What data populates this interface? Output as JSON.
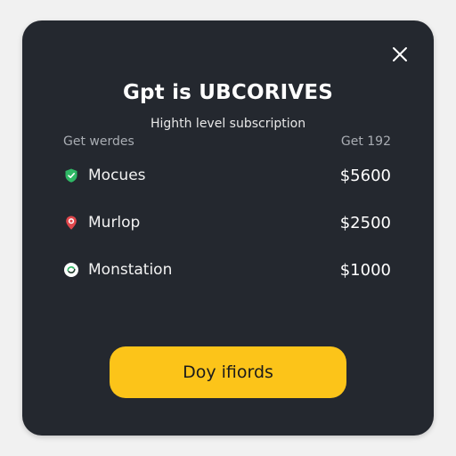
{
  "dialog": {
    "title": "Gpt is UBCORIVES",
    "subtitle": "Highth level subscription",
    "close_icon": "close-icon"
  },
  "table": {
    "header_left": "Get werdes",
    "header_right": "Get 192"
  },
  "plans": [
    {
      "name": "Mocues",
      "price": "$5600",
      "icon": "shield-check-icon",
      "icon_color": "#2fb865"
    },
    {
      "name": "Murlop",
      "price": "$2500",
      "icon": "location-pin-icon",
      "icon_color": "#e0474c"
    },
    {
      "name": "Monstation",
      "price": "$1000",
      "icon": "refresh-badge-icon",
      "icon_color": "#2fb865"
    }
  ],
  "cta": {
    "label": "Doy ifiords",
    "color": "#fcc419"
  },
  "colors": {
    "modal_bg": "#24282f",
    "page_bg": "#f1f1f1"
  }
}
